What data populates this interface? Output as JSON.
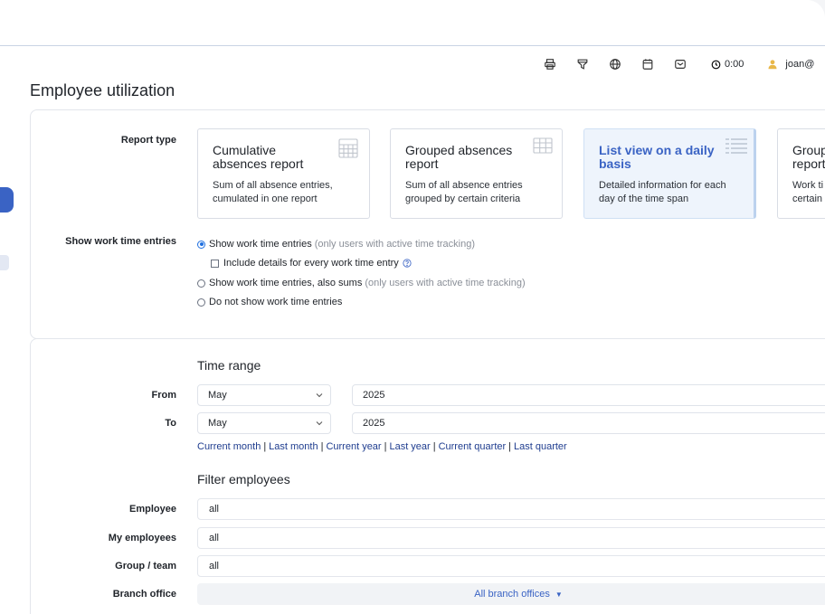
{
  "header": {
    "timer": "0:00",
    "user": "joan@"
  },
  "page": {
    "title": "Employee utilization"
  },
  "report_type": {
    "label": "Report type",
    "options": [
      {
        "title": "Cumulative absences report",
        "desc": "Sum of all absence entries, cumulated in one report",
        "icon": "calculator-icon"
      },
      {
        "title": "Grouped absences report",
        "desc": "Sum of all absence entries grouped by certain criteria",
        "icon": "table-icon"
      },
      {
        "title": "List view on a daily basis",
        "desc": "Detailed information for each day of the time span",
        "icon": "list-icon",
        "selected": true
      },
      {
        "title": "Group report",
        "desc": "Work ti certain",
        "icon": ""
      }
    ]
  },
  "work_time": {
    "label": "Show work time entries",
    "options": [
      {
        "text": "Show work time entries",
        "note": "(only users with active time tracking)",
        "selected": true
      },
      {
        "text": "Show work time entries, also sums",
        "note": "(only users with active time tracking)",
        "selected": false
      },
      {
        "text": "Do not show work time entries",
        "note": "",
        "selected": false
      }
    ],
    "include_details": "Include details for every work time entry",
    "include_details_checked": false
  },
  "time_range": {
    "heading": "Time range",
    "from_label": "From",
    "to_label": "To",
    "from_month": "May",
    "from_year": "2025",
    "to_month": "May",
    "to_year": "2025",
    "quick_links": [
      "Current month",
      "Last month",
      "Current year",
      "Last year",
      "Current quarter",
      "Last quarter"
    ],
    "separator": "|"
  },
  "filter": {
    "heading": "Filter employees",
    "employee_label": "Employee",
    "employee_value": "all",
    "my_employees_label": "My employees",
    "my_employees_value": "all",
    "group_label": "Group / team",
    "group_value": "all",
    "branch_label": "Branch office",
    "branch_value": "All branch offices"
  },
  "colors": {
    "accent": "#3a63c4",
    "link": "#1f3d8f",
    "radio": "#1f6fe0"
  }
}
